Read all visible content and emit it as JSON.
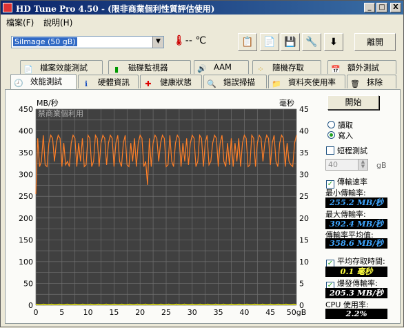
{
  "window": {
    "title": "HD Tune Pro 4.50 - (限非商業個利性質評估使用)",
    "minimize": "_",
    "maximize": "□",
    "close": "X"
  },
  "menu": [
    "檔案(F)",
    "說明(H)"
  ],
  "toolbar": {
    "drive": "SiImage  (50 gB)",
    "temperature": "-- ℃",
    "exit_label": "離開"
  },
  "tabs_top": [
    "檔案效能測試",
    "磁碟監視器",
    "AAM",
    "隨機存取",
    "額外測試"
  ],
  "tabs_bottom": [
    "效能測試",
    "硬體資訊",
    "健康狀態",
    "錯誤掃描",
    "資料夾使用率",
    "抹除"
  ],
  "chart": {
    "left_unit": "MB/秒",
    "right_unit": "毫秒",
    "watermark": "禁商業個利用",
    "y_left_ticks": [
      "450",
      "400",
      "350",
      "300",
      "250",
      "200",
      "150",
      "100",
      "50",
      "0"
    ],
    "y_right_ticks": [
      "45",
      "40",
      "35",
      "30",
      "25",
      "20",
      "15",
      "10",
      "5",
      "0"
    ],
    "x_ticks": [
      "0",
      "5",
      "10",
      "15",
      "20",
      "25",
      "30",
      "35",
      "40",
      "45",
      "50gB"
    ]
  },
  "chart_data": {
    "type": "line",
    "xlabel": "gB",
    "ylabel_left": "MB/秒",
    "ylabel_right": "毫秒",
    "xlim": [
      0,
      50
    ],
    "ylim_left": [
      0,
      450
    ],
    "ylim_right": [
      0,
      45
    ],
    "grid": true,
    "series": [
      {
        "name": "傳輸速率",
        "color": "#ff7f27",
        "axis": "left",
        "summary": {
          "min": 255.2,
          "max": 392.4,
          "avg": 358.6
        },
        "pattern": "oscillating approx. 310-390 MB/s across 0-50 gB, brief dip to ~275 near 21.5 gB, starting at ~255 at 0 gB"
      },
      {
        "name": "存取時間",
        "color": "#ffff00",
        "axis": "right",
        "summary": {
          "avg": 0.1
        },
        "pattern": "flat near 0 ms"
      }
    ]
  },
  "side": {
    "start_label": "開始",
    "read_label": "讀取",
    "write_label": "寫入",
    "short_test_label": "短程測試",
    "short_test_value": "40",
    "short_test_unit": "gB",
    "transfer_rate_label": "傳輸速率",
    "min_label": "最小傳輸率:",
    "min_value": "255.2 MB/秒",
    "max_label": "最大傳輸率:",
    "max_value": "392.4 MB/秒",
    "avg_label": "傳輸率平均值:",
    "avg_value": "358.6 MB/秒",
    "access_label": "平均存取時間:",
    "access_value": "0.1 毫秒",
    "burst_label": "爆發傳輸率:",
    "burst_value": "205.3 MB/秒",
    "cpu_label": "CPU 使用率:",
    "cpu_value": "2.2%"
  },
  "colors": {
    "chart_bg": "#404040",
    "grid": "#707070",
    "transfer": "#ff7f27",
    "access": "#ffff00"
  }
}
